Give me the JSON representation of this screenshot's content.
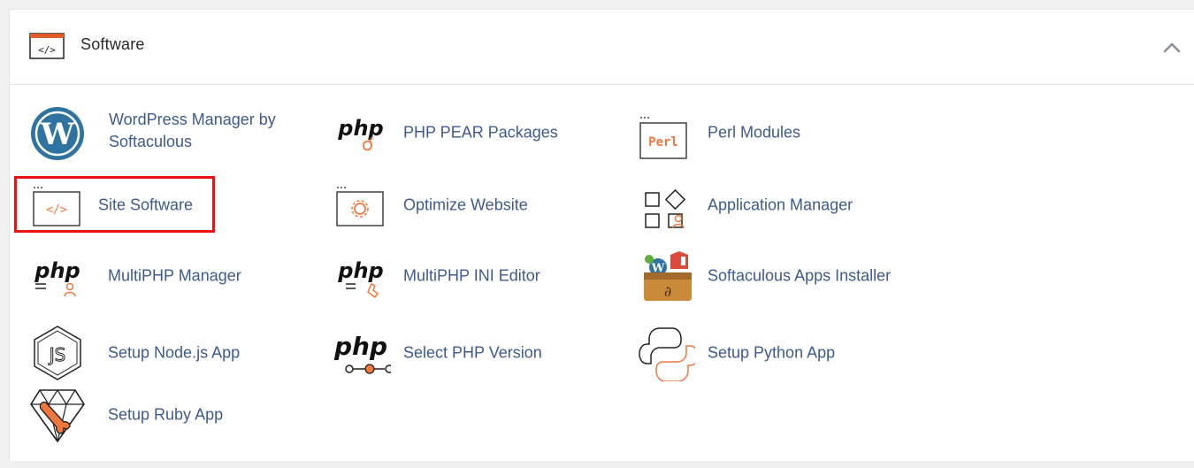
{
  "section": {
    "title": "Software",
    "collapse_icon": "chevron-up-icon"
  },
  "items": [
    {
      "label": "WordPress Manager by",
      "label2": "Softaculous",
      "icon": "wordpress-icon"
    },
    {
      "label": "PHP PEAR Packages",
      "icon": "php-pear-icon"
    },
    {
      "label": "Perl Modules",
      "icon": "perl-icon"
    },
    {
      "label": "Site Software",
      "icon": "code-window-icon",
      "highlighted": true
    },
    {
      "label": "Optimize Website",
      "icon": "optimize-gear-icon"
    },
    {
      "label": "Application Manager",
      "icon": "app-grid-icon"
    },
    {
      "label": "MultiPHP Manager",
      "icon": "multiphp-manager-icon"
    },
    {
      "label": "MultiPHP INI Editor",
      "icon": "multiphp-ini-icon"
    },
    {
      "label": "Softaculous Apps Installer",
      "icon": "softaculous-box-icon"
    },
    {
      "label": "Setup Node.js App",
      "icon": "nodejs-icon"
    },
    {
      "label": "Select PHP Version",
      "icon": "php-version-icon"
    },
    {
      "label": "Setup Python App",
      "icon": "python-icon"
    },
    {
      "label": "Setup Ruby App",
      "icon": "ruby-icon"
    }
  ],
  "colors": {
    "link": "#3d5a91",
    "accent": "#f0763c",
    "highlight": "#ee1111"
  },
  "icon_text": {
    "perl": "Perl",
    "php": "php"
  }
}
